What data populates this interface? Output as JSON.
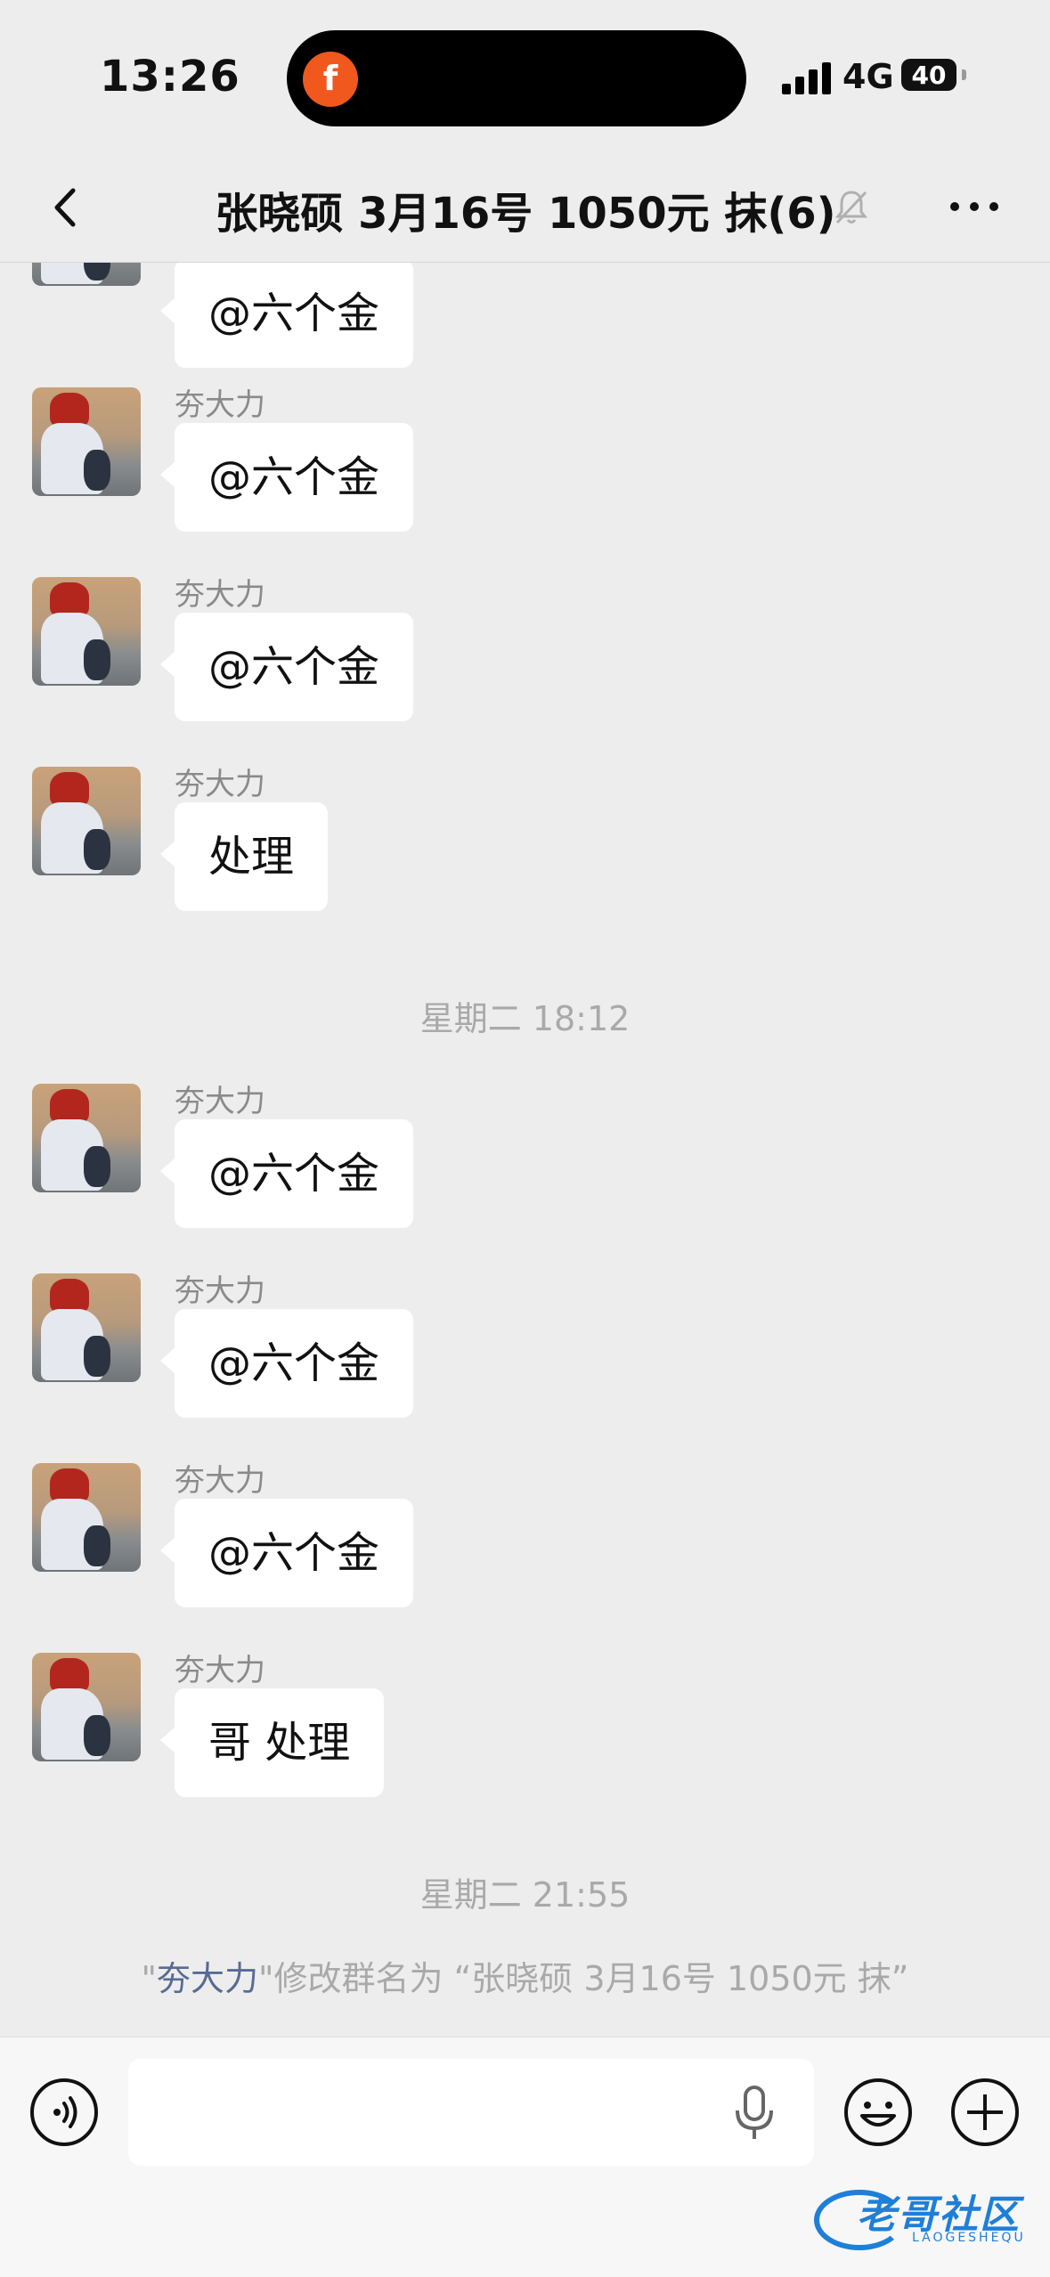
{
  "status_bar": {
    "time": "13:26",
    "network": "4G",
    "battery": "40"
  },
  "nav": {
    "title": "张晓硕 3月16号 1050元 抹(6)"
  },
  "messages": [
    {
      "sender": "",
      "text": "@六个金"
    },
    {
      "sender": "夯大力",
      "text": "@六个金"
    },
    {
      "sender": "夯大力",
      "text": "@六个金"
    },
    {
      "sender": "夯大力",
      "text": "处理"
    },
    {
      "sender": "夯大力",
      "text": "@六个金"
    },
    {
      "sender": "夯大力",
      "text": "@六个金"
    },
    {
      "sender": "夯大力",
      "text": "@六个金"
    },
    {
      "sender": "夯大力",
      "text": "哥 处理"
    }
  ],
  "timestamps": [
    "星期二 18:12",
    "星期二 21:55"
  ],
  "system_notice": {
    "quote_open": "\"",
    "name": "夯大力",
    "rest": "\"修改群名为 “张晓硕 3月16号 1050元 抹”"
  },
  "input": {
    "placeholder": ""
  },
  "watermark": {
    "text": "老哥社区",
    "sub": "LAOGESHEQU"
  },
  "colors": {
    "background": "#ededed",
    "link": "#576b95",
    "bubble": "#ffffff"
  }
}
